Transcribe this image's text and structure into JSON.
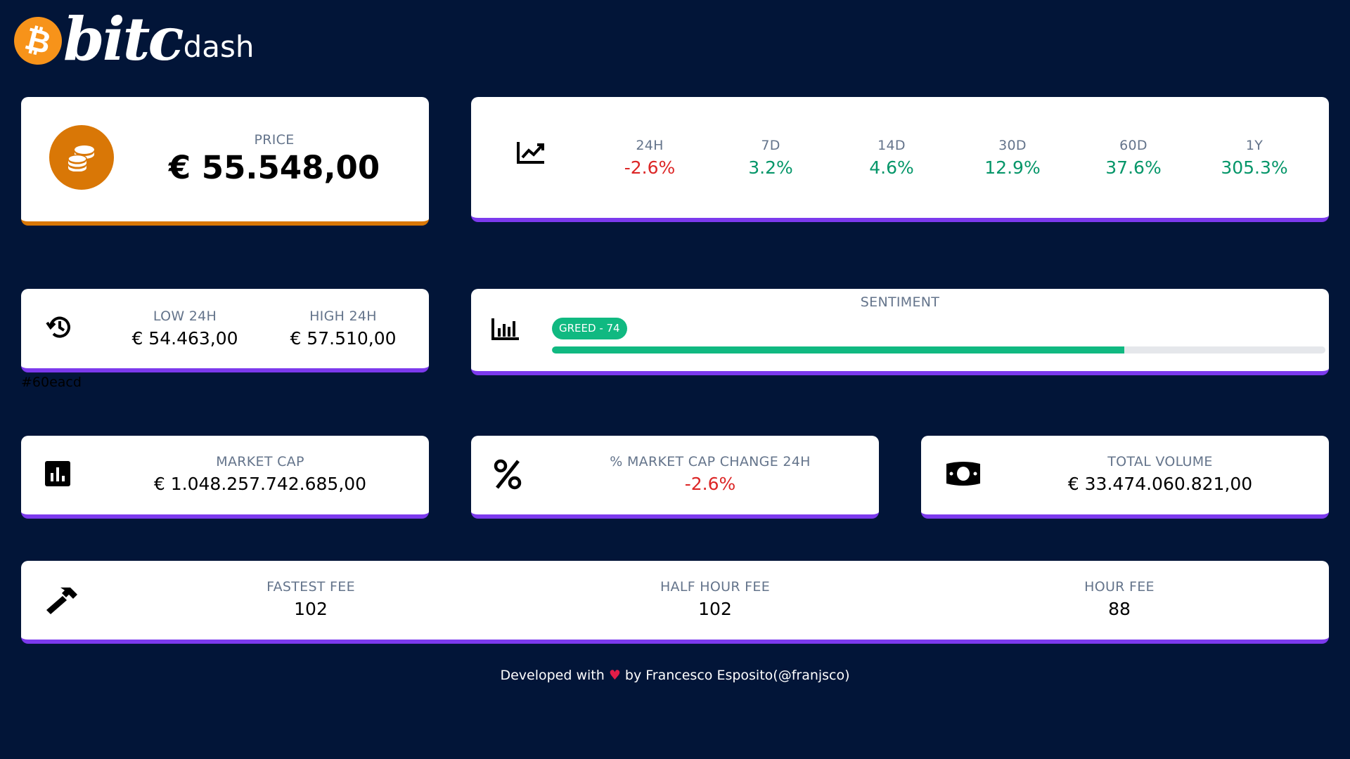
{
  "brand": {
    "main": "bitc",
    "sub": "dash",
    "coin_symbol": "₿"
  },
  "price": {
    "label": "PRICE",
    "value": "€ 55.548,00"
  },
  "changes": [
    {
      "label": "24H",
      "value": "-2.6%"
    },
    {
      "label": "7D",
      "value": "3.2%"
    },
    {
      "label": "14D",
      "value": "4.6%"
    },
    {
      "label": "30D",
      "value": "12.9%"
    },
    {
      "label": "60D",
      "value": "37.6%"
    },
    {
      "label": "1Y",
      "value": "305.3%"
    }
  ],
  "range": {
    "low_label": "LOW 24H",
    "low_value": "€ 54.463,00",
    "high_label": "HIGH 24H",
    "high_value": "€ 57.510,00"
  },
  "hex_note": "#60eacd",
  "sentiment": {
    "title": "SENTIMENT",
    "badge": "GREED - 74",
    "level_percent": 74
  },
  "market_cap": {
    "label": "MARKET CAP",
    "value": "€ 1.048.257.742.685,00"
  },
  "market_cap_change": {
    "label": "% MARKET CAP CHANGE 24H",
    "value": "-2.6%"
  },
  "total_volume": {
    "label": "TOTAL VOLUME",
    "value": "€ 33.474.060.821,00"
  },
  "fees": [
    {
      "label": "FASTEST FEE",
      "value": "102"
    },
    {
      "label": "HALF HOUR FEE",
      "value": "102"
    },
    {
      "label": "HOUR FEE",
      "value": "88"
    }
  ],
  "footer": {
    "prefix": "Developed with",
    "heart": "♥",
    "suffix": "by Francesco Esposito(@franjsco)"
  },
  "colors": {
    "background": "#021538",
    "accent": "#7c3aed",
    "orange": "#d97706",
    "green": "#059669",
    "red": "#dc2626"
  }
}
